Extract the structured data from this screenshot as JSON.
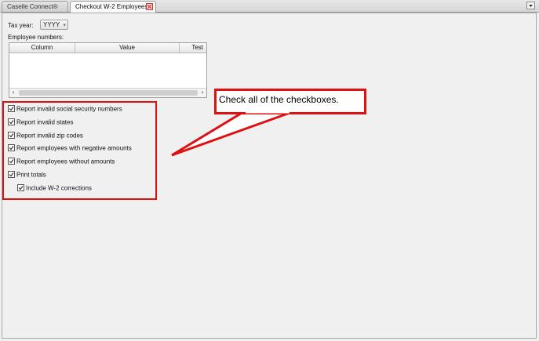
{
  "tabs": [
    {
      "label": "Caselle Connect®"
    },
    {
      "label": "Checkout W-2 Employees"
    }
  ],
  "form": {
    "tax_year_label": "Tax year:",
    "tax_year_value": "YYYY",
    "employee_numbers_label": "Employee numbers:",
    "grid_columns": [
      "Column",
      "Value",
      "Test"
    ],
    "checkboxes": [
      {
        "label": "Report invalid social security numbers",
        "checked": true
      },
      {
        "label": "Report invalid states",
        "checked": true
      },
      {
        "label": "Report invalid zip codes",
        "checked": true
      },
      {
        "label": "Report employees with negative amounts",
        "checked": true
      },
      {
        "label": "Report employees without amounts",
        "checked": true
      },
      {
        "label": "Print totals",
        "checked": true
      },
      {
        "label": "Include W-2 corrections",
        "checked": true
      }
    ]
  },
  "annotation": {
    "callout_text": "Check all of the checkboxes.",
    "color": "#e01010"
  },
  "icons": [
    "close-icon",
    "dropdown-arrow-icon",
    "chevron-down-icon",
    "scroll-left-icon",
    "scroll-right-icon",
    "checkmark-icon"
  ]
}
